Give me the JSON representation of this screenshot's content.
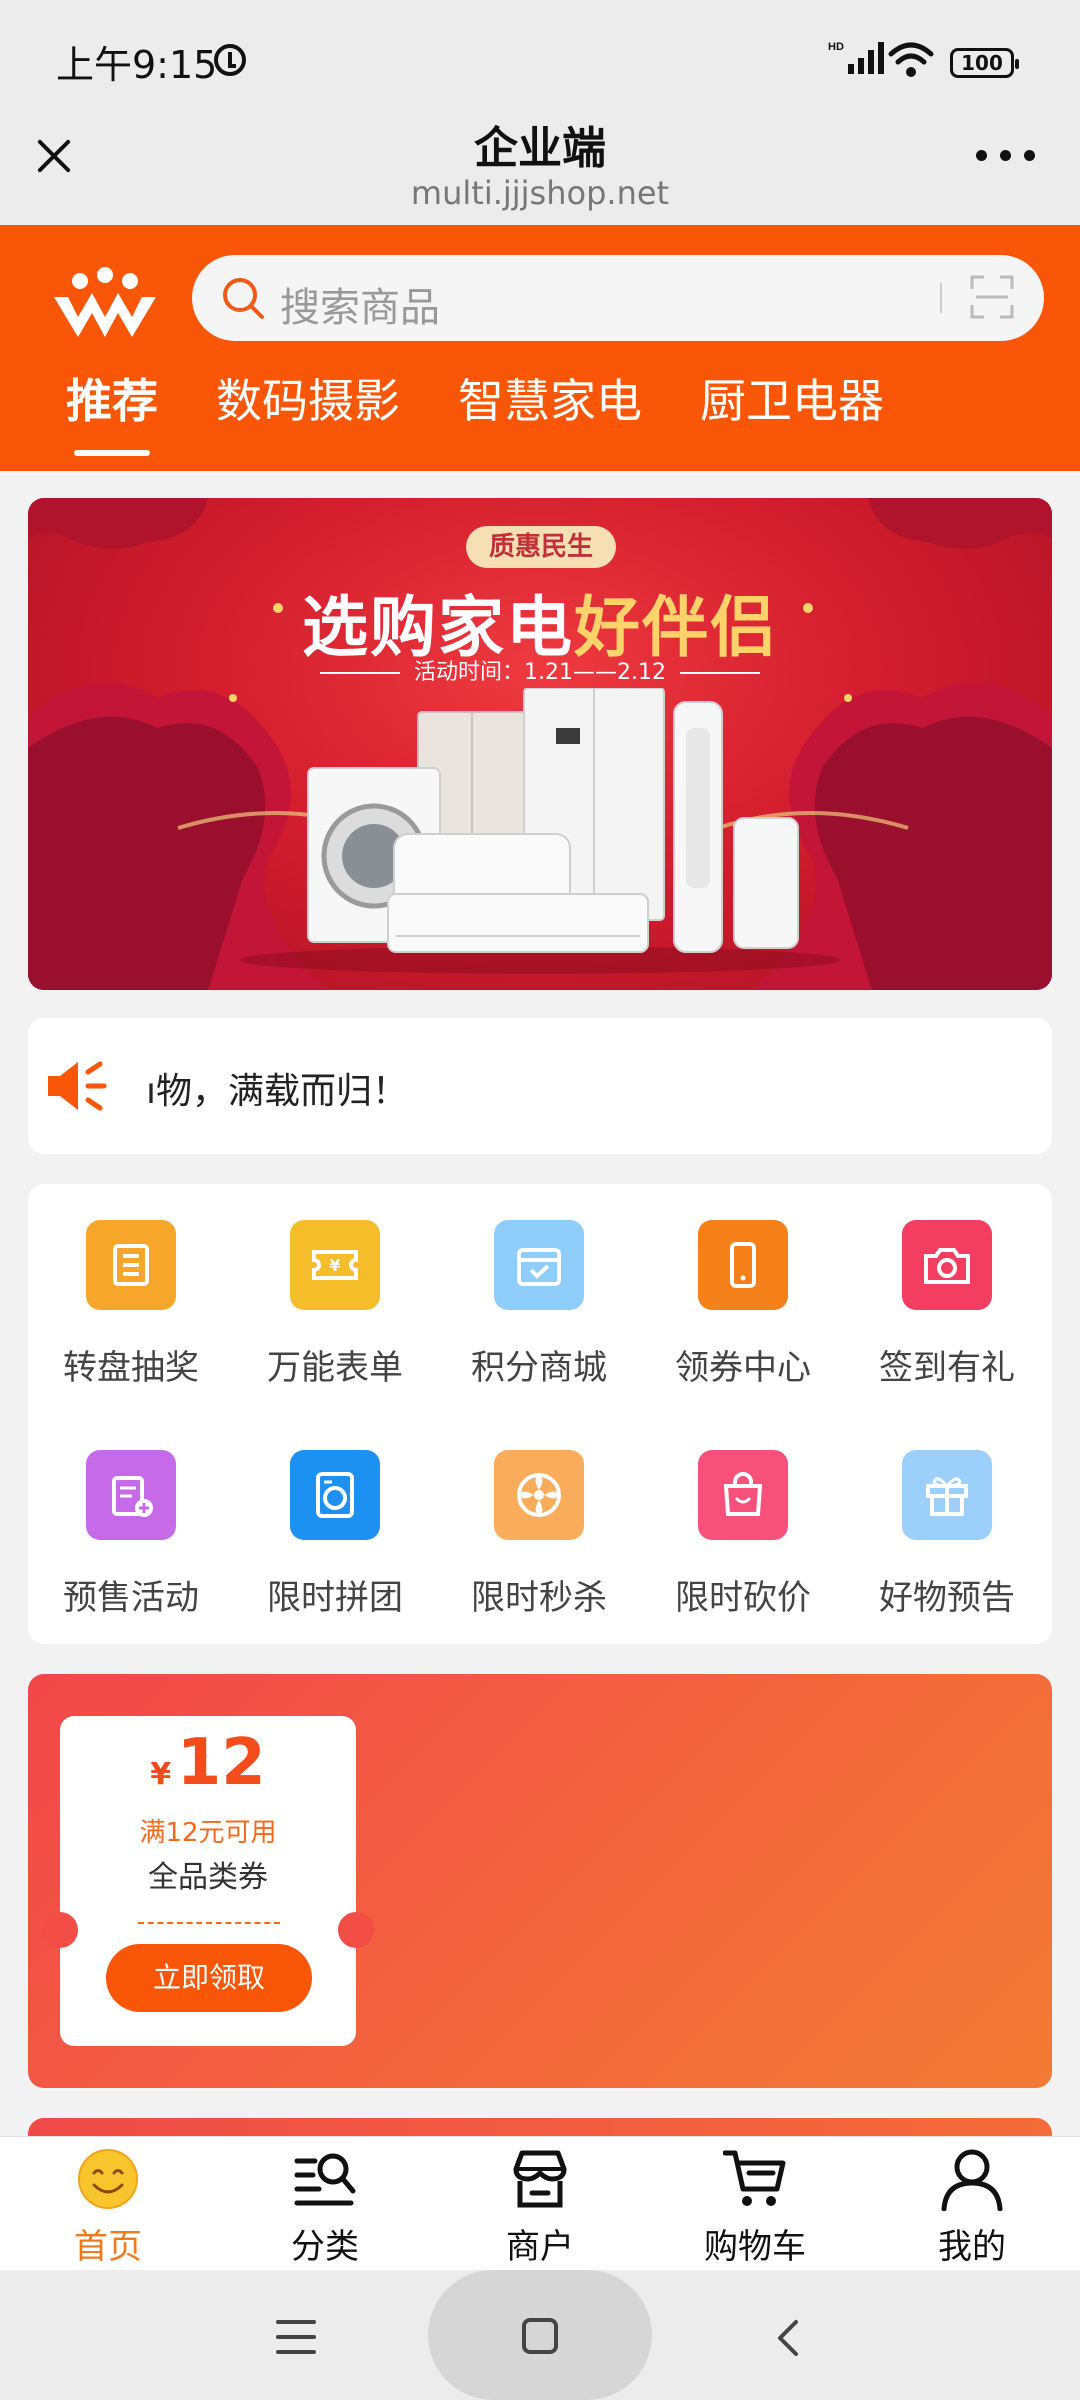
{
  "status_bar": {
    "time": "上午9:15",
    "battery": "100"
  },
  "title_bar": {
    "title": "企业端",
    "url": "multi.jjjshop.net"
  },
  "search": {
    "placeholder": "搜索商品"
  },
  "tabs": [
    {
      "label": "推荐",
      "active": true
    },
    {
      "label": "数码摄影"
    },
    {
      "label": "智慧家电"
    },
    {
      "label": "厨卫电器"
    }
  ],
  "banner": {
    "tag": "质惠民生",
    "title_part1": "选购家电",
    "title_part2": "好伴侣",
    "date": "活动时间：1.21——2.12"
  },
  "notice": {
    "text": "ı物，满载而归！"
  },
  "menu": [
    {
      "label": "转盘抽奖",
      "icon": "lottery-icon",
      "color": "#f6a628"
    },
    {
      "label": "万能表单",
      "icon": "ticket-icon",
      "color": "#f6bd2a"
    },
    {
      "label": "积分商城",
      "icon": "calendar-icon",
      "color": "#8fcdfa"
    },
    {
      "label": "领券中心",
      "icon": "phone-icon",
      "color": "#f57f18"
    },
    {
      "label": "签到有礼",
      "icon": "camera-icon",
      "color": "#f33e61"
    },
    {
      "label": "预售活动",
      "icon": "clipboard-icon",
      "color": "#c66ae8"
    },
    {
      "label": "限时拼团",
      "icon": "washer-icon",
      "color": "#1c91f2"
    },
    {
      "label": "限时秒杀",
      "icon": "fan-icon",
      "color": "#f9ac5a"
    },
    {
      "label": "限时砍价",
      "icon": "bag-icon",
      "color": "#f7507a"
    },
    {
      "label": "好物预告",
      "icon": "gift-icon",
      "color": "#9ccffa"
    }
  ],
  "coupon": {
    "currency": "¥",
    "value": "12",
    "condition": "满12元可用",
    "scope": "全品类券",
    "button": "立即领取"
  },
  "bottom_nav": [
    {
      "label": "首页",
      "icon": "smiley-icon",
      "active": true
    },
    {
      "label": "分类",
      "icon": "category-search-icon"
    },
    {
      "label": "商户",
      "icon": "store-icon"
    },
    {
      "label": "购物车",
      "icon": "cart-icon"
    },
    {
      "label": "我的",
      "icon": "user-icon"
    }
  ],
  "colors": {
    "brand": "#fa5608",
    "active_nav": "#f07a1a"
  }
}
